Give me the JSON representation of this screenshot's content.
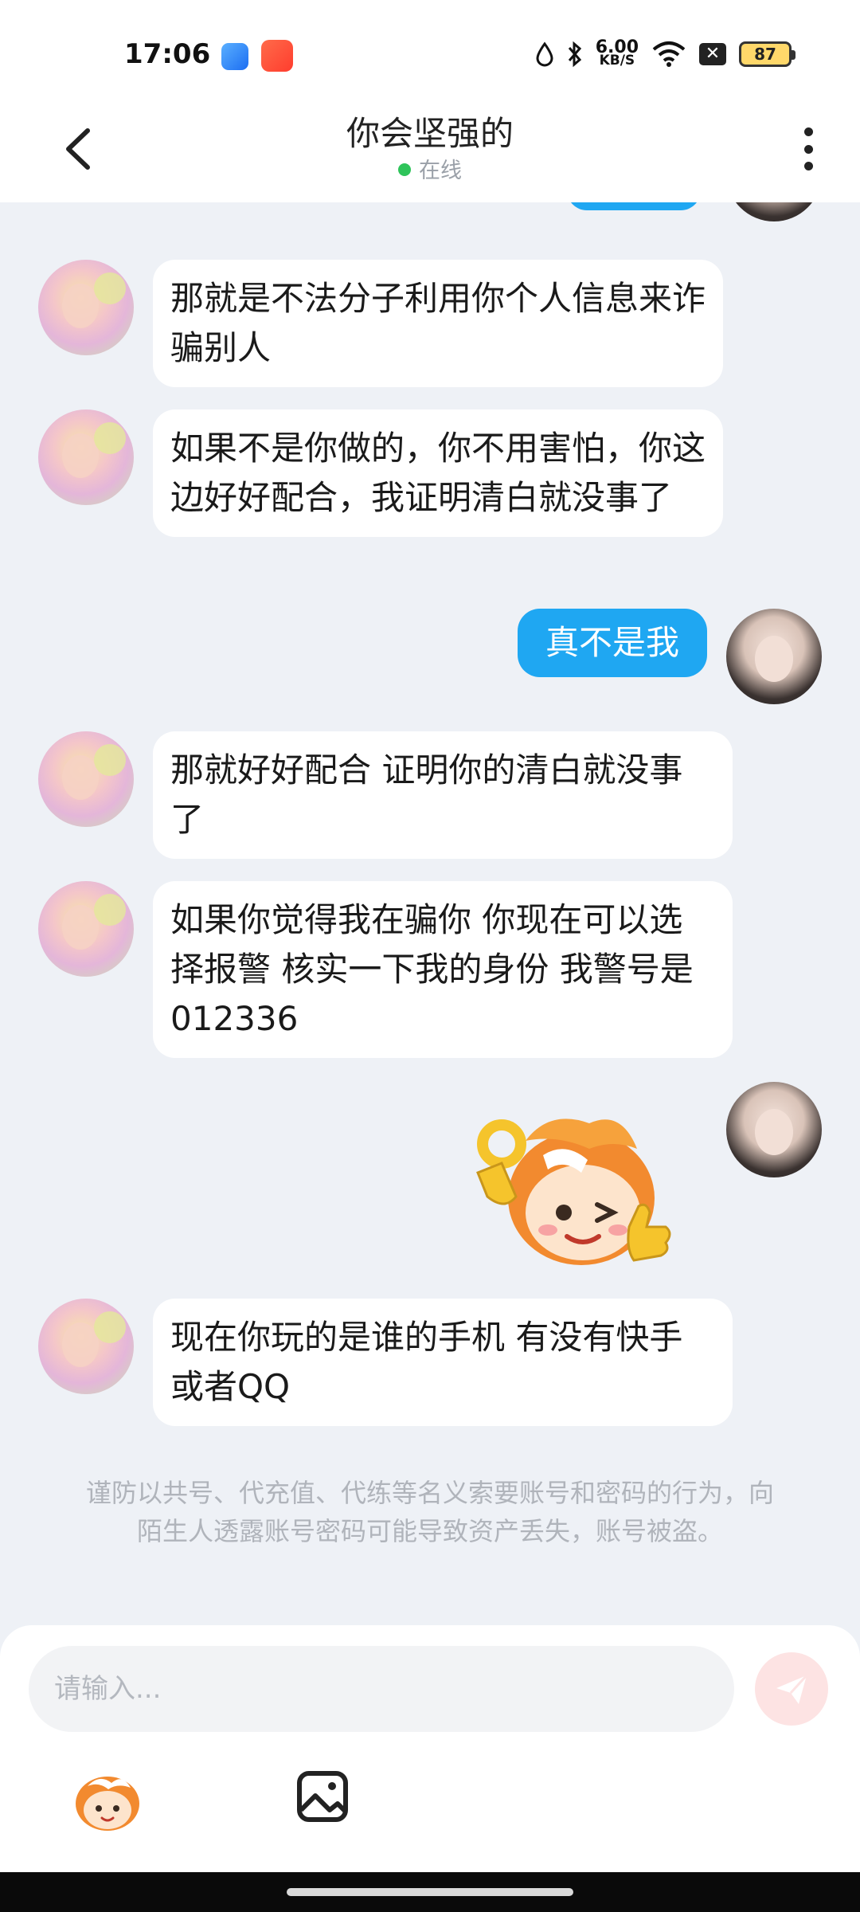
{
  "status_bar": {
    "time": "17:06",
    "net_speed_value": "6.00",
    "net_speed_unit": "KB/S",
    "battery": "87",
    "x_label": "✕"
  },
  "header": {
    "title": "你会坚强的",
    "status": "在线"
  },
  "messages": [
    {
      "sender": "peer",
      "text": "那就是不法分子利用你个人信息来诈骗别人"
    },
    {
      "sender": "peer",
      "text": "如果不是你做的，你不用害怕，你这边好好配合，我证明清白就没事了"
    },
    {
      "sender": "me",
      "text": "真不是我"
    },
    {
      "sender": "peer",
      "text": "那就好好配合 证明你的清白就没事了"
    },
    {
      "sender": "peer",
      "text": "如果你觉得我在骗你 你现在可以选择报警 核实一下我的身份 我警号是012336"
    },
    {
      "sender": "me",
      "type": "sticker",
      "sticker": "monkey-ok-thumbs-up-sticker"
    },
    {
      "sender": "peer",
      "text": "现在你玩的是谁的手机 有没有快手或者QQ"
    }
  ],
  "notice": "谨防以共号、代充值、代练等名义索要账号和密码的行为，向陌生人透露账号密码可能导致资产丢失，账号被盗。",
  "input": {
    "placeholder": "请输入..."
  },
  "colors": {
    "my_bubble": "#1fa7f2",
    "online": "#2ec45a",
    "background": "#eef1f6"
  },
  "icons": [
    "back-arrow-icon",
    "more-vertical-icon",
    "send-icon",
    "emoji-icon",
    "image-icon"
  ]
}
